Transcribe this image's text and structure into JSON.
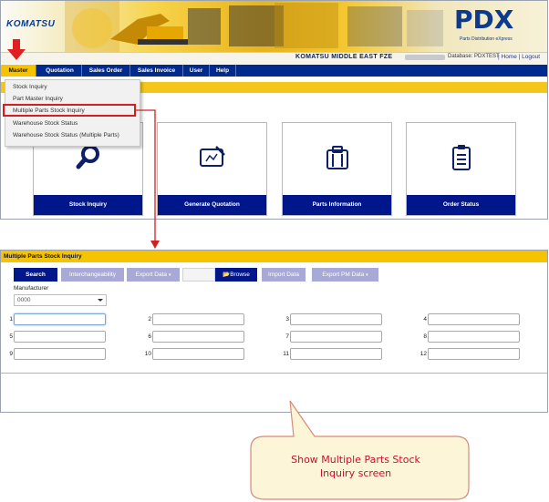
{
  "header": {
    "logo": "KOMATSU",
    "product": "PDX",
    "product_subtitle": "Parts Distribution eXpress",
    "company": "KOMATSU MIDDLE EAST FZE",
    "database": "Database: PDXTEST",
    "links": [
      "Home",
      "Logout"
    ]
  },
  "nav": {
    "items": [
      "Master",
      "Quotation",
      "Sales Order",
      "Sales Invoice",
      "User",
      "Help"
    ],
    "active": "Master"
  },
  "master_menu": {
    "items": [
      "Stock Inquiry",
      "Part Master Inquiry",
      "Multiple Parts Stock Inquiry",
      "Warehouse Stock Status",
      "Warehouse Stock Status (Multiple Parts)"
    ],
    "highlighted": "Multiple Parts Stock Inquiry"
  },
  "tiles": [
    {
      "label": "Stock Inquiry",
      "icon": "magnifier-icon"
    },
    {
      "label": "Generate Quotation",
      "icon": "tablet-edit-icon"
    },
    {
      "label": "Parts Information",
      "icon": "binder-icon"
    },
    {
      "label": "Order Status",
      "icon": "clipboard-icon"
    }
  ],
  "panel": {
    "title": "Multiple Parts Stock Inquiry",
    "buttons": {
      "search": "Search",
      "interchangeability": "Interchangeability",
      "export_data": "Export Data",
      "browse": "Browse",
      "import_data": "Import Data",
      "export_pm_data": "Export PM Data"
    },
    "manufacturer_label": "Manufacturer",
    "manufacturer_value": "0000",
    "part_fields": [
      "1",
      "2",
      "3",
      "4",
      "5",
      "6",
      "7",
      "8",
      "9",
      "10",
      "11",
      "12"
    ]
  },
  "callout": {
    "line1": "Show Multiple Parts Stock",
    "line2": "Inquiry screen"
  },
  "colors": {
    "nav_blue": "#002a8e",
    "tile_blue": "#00178c",
    "accent_yellow": "#f6c300",
    "highlight_red": "#d22020",
    "muted_button": "#a8a9d6"
  }
}
